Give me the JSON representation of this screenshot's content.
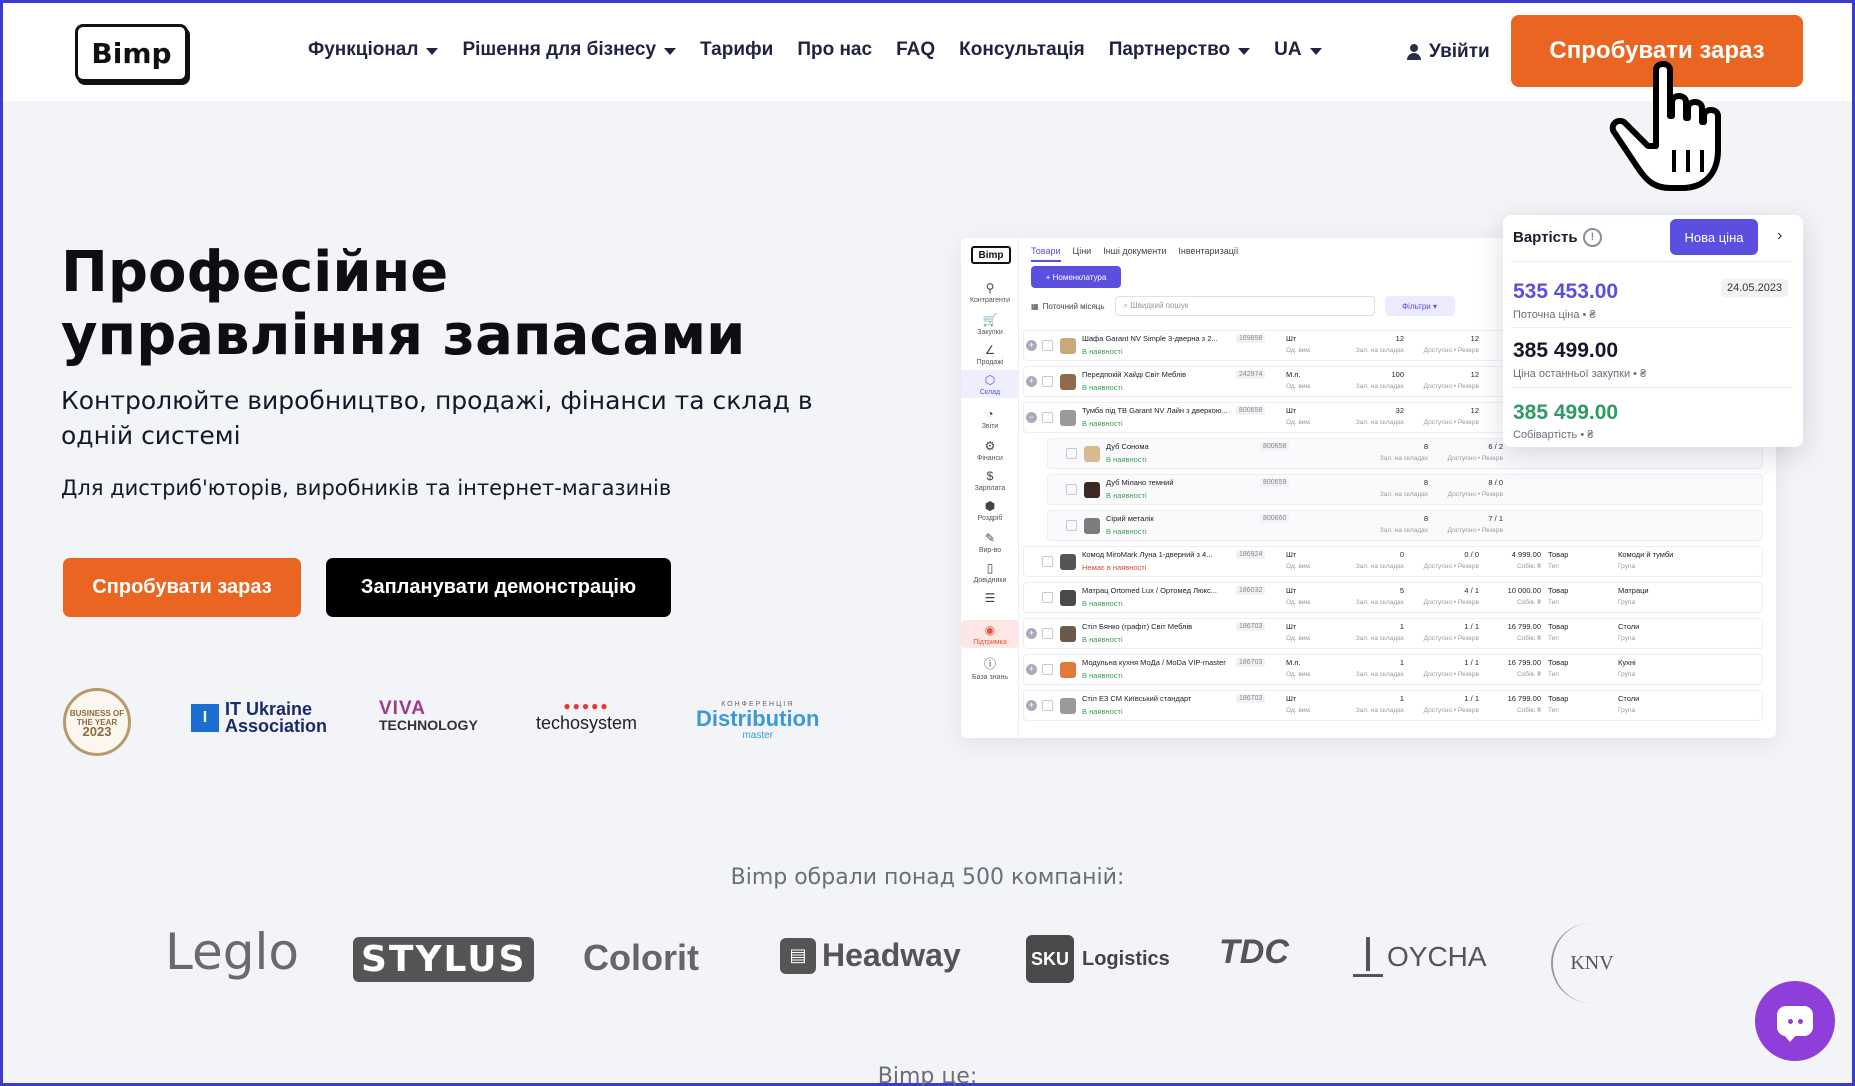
{
  "header": {
    "logo": "Bimp",
    "nav": [
      {
        "label": "Функціонал",
        "dropdown": true
      },
      {
        "label": "Рішення для бізнесу",
        "dropdown": true
      },
      {
        "label": "Тарифи",
        "dropdown": false
      },
      {
        "label": "Про нас",
        "dropdown": false
      },
      {
        "label": "FAQ",
        "dropdown": false
      },
      {
        "label": "Консультація",
        "dropdown": false
      },
      {
        "label": "Партнерство",
        "dropdown": true
      },
      {
        "label": "UA",
        "dropdown": true
      }
    ],
    "login": "Увійти",
    "try_button": "Спробувати зараз"
  },
  "hero": {
    "title": "Професійне управління запасами",
    "subtitle": "Контролюйте виробництво, продажі, фінанси та склад в одній системі",
    "audience": "Для дистриб'юторів, виробників та інтернет-магазинів",
    "try_button": "Спробувати зараз",
    "demo_button": "Запланувати демонстрацію"
  },
  "awards": {
    "business_year": {
      "line1": "BUSINESS OF",
      "line2": "THE YEAR",
      "year": "2023"
    },
    "itua": {
      "icon": "I",
      "line1": "IT Ukraine",
      "line2": "Association"
    },
    "viva": {
      "line1": "VIVA",
      "line2": "TECHNOLOGY"
    },
    "techo": {
      "dots": "●●●●●",
      "label": "techosystem"
    },
    "distribution": {
      "top": "КОНФЕРЕНЦІЯ",
      "name": "Distribution",
      "sub": "master"
    }
  },
  "app": {
    "logo": "Bimp",
    "sidebar": [
      {
        "icon": "⚲",
        "label": "Контрагенти",
        "state": ""
      },
      {
        "icon": "🛒",
        "label": "Закупки",
        "state": ""
      },
      {
        "icon": "∠",
        "label": "Продажі",
        "state": ""
      },
      {
        "icon": "⬡",
        "label": "Склад",
        "state": "active"
      },
      {
        "icon": "◔",
        "label": "Звіти",
        "state": ""
      },
      {
        "icon": "⚙",
        "label": "Фінанси",
        "state": ""
      },
      {
        "icon": "$",
        "label": "Зарплата",
        "state": ""
      },
      {
        "icon": "⬢",
        "label": "Роздріб",
        "state": ""
      },
      {
        "icon": "✎",
        "label": "Вир-во",
        "state": ""
      },
      {
        "icon": "▯",
        "label": "Довідники",
        "state": ""
      },
      {
        "icon": "☰",
        "label": "",
        "state": ""
      },
      {
        "icon": "◉",
        "label": "Підтримка",
        "state": "support"
      },
      {
        "icon": "ⓘ",
        "label": "База знань",
        "state": ""
      }
    ],
    "tabs": [
      "Товари",
      "Ціни",
      "Інші документи",
      "Інвентаризації"
    ],
    "nomenclature_button": "+ Номенклатура",
    "month": "Поточний місяць",
    "search_placeholder": "Швидкий пошук",
    "filter_button": "Фільтри",
    "labels": {
      "unit": "Од. вим.",
      "stock": "Зал. на складах",
      "reserve": "Доступно • Резерв",
      "cost": "Собів. ₴",
      "type": "Тип",
      "group": "Група"
    },
    "rows": [
      {
        "toggle": "+",
        "child": false,
        "thumb": "#c9a87a",
        "name": "Шафа Garant NV Simple 3-дверна з 2...",
        "avail": "В наявності",
        "avail_color": "#3a9e5a",
        "code": "169858",
        "unit": "Шт",
        "stock": "12",
        "reserve": "12",
        "price": "",
        "type": "",
        "group": ""
      },
      {
        "toggle": "+",
        "child": false,
        "thumb": "#8e6c48",
        "name": "Передпокій Хайді Світ Меблів",
        "avail": "В наявності",
        "avail_color": "#3a9e5a",
        "code": "242974",
        "unit": "М.п.",
        "stock": "100",
        "reserve": "12",
        "price": "",
        "type": "",
        "group": ""
      },
      {
        "toggle": "−",
        "child": false,
        "thumb": "#9a9a9a",
        "name": "Тумба під ТВ Garant NV Лайн з дверкою...",
        "avail": "В наявності",
        "avail_color": "#3a9e5a",
        "code": "800658",
        "unit": "Шт",
        "stock": "32",
        "reserve": "12",
        "price": "",
        "type": "",
        "group": ""
      },
      {
        "toggle": "",
        "child": true,
        "thumb": "#d9b98f",
        "name": "Дуб Сонома",
        "avail": "В наявності",
        "avail_color": "#3a9e5a",
        "code": "800658",
        "unit": "",
        "stock": "8",
        "reserve": "6 / 2",
        "price": "",
        "type": "",
        "group": ""
      },
      {
        "toggle": "",
        "child": true,
        "thumb": "#3a2a22",
        "name": "Дуб Мілано темний",
        "avail": "В наявності",
        "avail_color": "#3a9e5a",
        "code": "800659",
        "unit": "",
        "stock": "8",
        "reserve": "8 / 0",
        "price": "",
        "type": "",
        "group": ""
      },
      {
        "toggle": "",
        "child": true,
        "thumb": "#7c7c7c",
        "name": "Сірий металік",
        "avail": "В наявності",
        "avail_color": "#3a9e5a",
        "code": "800660",
        "unit": "",
        "stock": "8",
        "reserve": "7 / 1",
        "price": "",
        "type": "",
        "group": ""
      },
      {
        "toggle": "",
        "child": false,
        "thumb": "#555555",
        "name": "Комод MiroMark Луна 1-дверний з 4...",
        "avail": "Немає в наявності",
        "avail_color": "#d24b3a",
        "code": "186924",
        "unit": "Шт",
        "stock": "0",
        "reserve": "0 / 0",
        "price": "4 999.00",
        "type": "Товар",
        "group": "Комоди й тумби"
      },
      {
        "toggle": "",
        "child": false,
        "thumb": "#4a4a4a",
        "name": "Матрац Ortomed Lux / Ортомед Люкс...",
        "avail": "В наявності",
        "avail_color": "#3a9e5a",
        "code": "186032",
        "unit": "Шт",
        "stock": "5",
        "reserve": "4 / 1",
        "price": "10 000.00",
        "type": "Товар",
        "group": "Матраци"
      },
      {
        "toggle": "+",
        "child": false,
        "thumb": "#6b5a4a",
        "name": "Стіл Бянко (графіт) Світ Меблів",
        "avail": "В наявності",
        "avail_color": "#3a9e5a",
        "code": "186703",
        "unit": "Шт",
        "stock": "1",
        "reserve": "1 / 1",
        "price": "16 799.00",
        "type": "Товар",
        "group": "Столи"
      },
      {
        "toggle": "+",
        "child": false,
        "thumb": "#e07a3a",
        "name": "Модульна кухня МоДа / MoDa VIP-master",
        "avail": "В наявності",
        "avail_color": "#3a9e5a",
        "code": "186703",
        "unit": "М.п.",
        "stock": "1",
        "reserve": "1 / 1",
        "price": "16 799.00",
        "type": "Товар",
        "group": "Кухні"
      },
      {
        "toggle": "+",
        "child": false,
        "thumb": "#9a9a9a",
        "name": "Стіл ЕЗ СМ Київський стандарт",
        "avail": "В наявності",
        "avail_color": "#3a9e5a",
        "code": "186703",
        "unit": "Шт",
        "stock": "1",
        "reserve": "1 / 1",
        "price": "16 799.00",
        "type": "Товар",
        "group": "Столи"
      }
    ]
  },
  "price_card": {
    "title": "Вартість",
    "info_icon": "!",
    "new_price_button": "Нова ціна",
    "arrow": "›",
    "current_price": {
      "value": "535 453.00",
      "label": "Поточна ціна • ₴",
      "color": "#5b4fe0",
      "date": "24.05.2023"
    },
    "last_purchase": {
      "value": "385 499.00",
      "label": "Ціна останньої закупки • ₴",
      "color": "#16182a"
    },
    "cost_price": {
      "value": "385 499.00",
      "label": "Собівартість • ₴",
      "color": "#2e9a64"
    }
  },
  "companies": {
    "heading": "Bimp обрали понад 500 компаній:",
    "list": [
      "Leglo",
      "STYLUS",
      "Colorit",
      "Headway",
      "SKU",
      "Logistics",
      "TDC",
      "OYCHA",
      "KNV"
    ]
  },
  "bimp_is": "Bimp це:",
  "colors": {
    "accent": "#ea6521",
    "brand_purple": "#5b4fe0",
    "chat": "#8f3fd9"
  }
}
